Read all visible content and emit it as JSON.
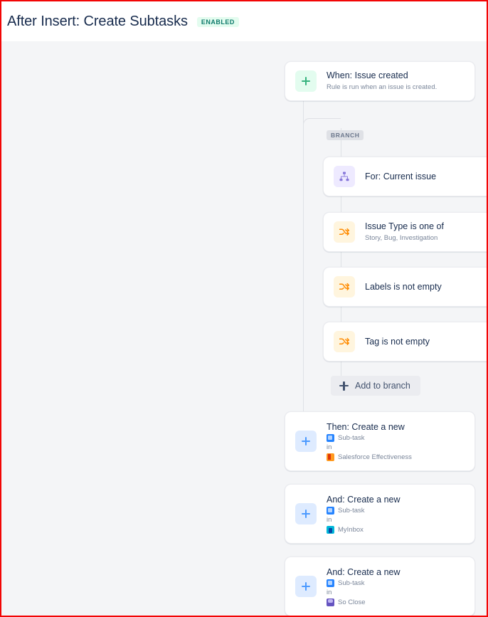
{
  "header": {
    "title": "After Insert: Create Subtasks",
    "status": "ENABLED"
  },
  "canvas": {
    "branch_pill": "BRANCH",
    "add_to_branch_label": "Add to branch",
    "in_word": "in",
    "trigger": {
      "icon": "plus-icon",
      "title": "When: Issue created",
      "subtitle": "Rule is run when an issue is created."
    },
    "branch_scope": {
      "icon": "sitemap-icon",
      "title": "For: Current issue",
      "subtitle": ""
    },
    "conditions": [
      {
        "icon": "condition-shuffle-icon",
        "title": "Issue Type is one of",
        "subtitle": "Story, Bug, Investigation"
      },
      {
        "icon": "condition-shuffle-icon",
        "title": "Labels is not empty",
        "subtitle": ""
      },
      {
        "icon": "condition-shuffle-icon",
        "title": "Tag is not empty",
        "subtitle": ""
      }
    ],
    "actions": [
      {
        "icon": "plus-icon",
        "title": "Then: Create a new",
        "issue_type": "Sub-task",
        "issue_type_icon": "subtask-icon",
        "project": "Salesforce Effectiveness",
        "project_icon": "salesforce-effectiveness-project-icon"
      },
      {
        "icon": "plus-icon",
        "title": "And: Create a new",
        "issue_type": "Sub-task",
        "issue_type_icon": "subtask-icon",
        "project": "MyInbox",
        "project_icon": "myinbox-project-icon"
      },
      {
        "icon": "plus-icon",
        "title": "And: Create a new",
        "issue_type": "Sub-task",
        "issue_type_icon": "subtask-icon",
        "project": "So Close",
        "project_icon": "so-close-project-icon"
      }
    ]
  },
  "colors": {
    "canvas_bg": "#f4f5f7",
    "trigger_accent": "#36b37e",
    "action_accent": "#4c9aff",
    "condition_accent": "#ff8b00",
    "branch_accent": "#8777d9",
    "enabled_badge_bg": "#e3fcef",
    "enabled_badge_text": "#0f7b6c"
  }
}
